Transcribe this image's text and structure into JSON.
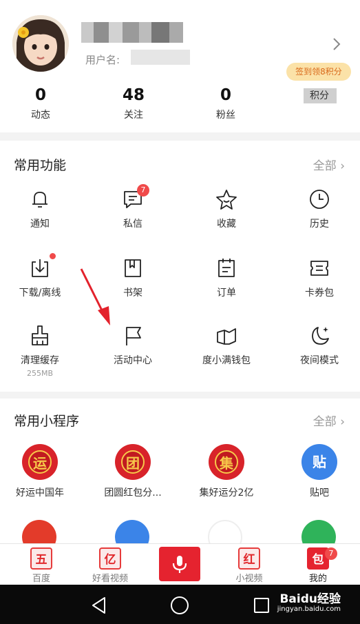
{
  "profile": {
    "username_label": "用户名:",
    "sign_badge": "签到领8积分",
    "stats": [
      {
        "value": "0",
        "label": "动态"
      },
      {
        "value": "48",
        "label": "关注"
      },
      {
        "value": "0",
        "label": "粉丝"
      },
      {
        "value": "",
        "label": "积分"
      }
    ]
  },
  "functions": {
    "title": "常用功能",
    "all": "全部",
    "items": [
      {
        "label": "通知",
        "icon": "bell-icon"
      },
      {
        "label": "私信",
        "icon": "message-icon",
        "badge": "7"
      },
      {
        "label": "收藏",
        "icon": "star-icon"
      },
      {
        "label": "历史",
        "icon": "clock-icon"
      },
      {
        "label": "下载/离线",
        "icon": "download-icon"
      },
      {
        "label": "书架",
        "icon": "bookshelf-icon"
      },
      {
        "label": "订单",
        "icon": "order-icon"
      },
      {
        "label": "卡券包",
        "icon": "coupon-icon"
      },
      {
        "label": "清理缓存",
        "icon": "broom-icon",
        "sub": "255MB"
      },
      {
        "label": "活动中心",
        "icon": "flag-icon"
      },
      {
        "label": "度小满钱包",
        "icon": "wallet-icon"
      },
      {
        "label": "夜间模式",
        "icon": "moon-icon"
      }
    ]
  },
  "mini_programs": {
    "title": "常用小程序",
    "all": "全部",
    "items": [
      {
        "label": "好运中国年",
        "glyph": "运",
        "color": "#d8232a"
      },
      {
        "label": "团圆红包分...",
        "glyph": "团",
        "color": "#d8232a"
      },
      {
        "label": "集好运分2亿",
        "glyph": "集",
        "color": "#d8232a"
      },
      {
        "label": "贴吧",
        "glyph": "贴",
        "color": "#3b84e8"
      }
    ]
  },
  "tabbar": {
    "items": [
      {
        "label": "百度",
        "glyph": "五"
      },
      {
        "label": "好看视频",
        "glyph": "亿"
      },
      {
        "label": "小视频",
        "glyph": "红"
      },
      {
        "label": "我的",
        "glyph": "包",
        "badge": "7"
      }
    ]
  },
  "watermark": {
    "brand": "Baidu经验",
    "url": "jingyan.baidu.com"
  }
}
